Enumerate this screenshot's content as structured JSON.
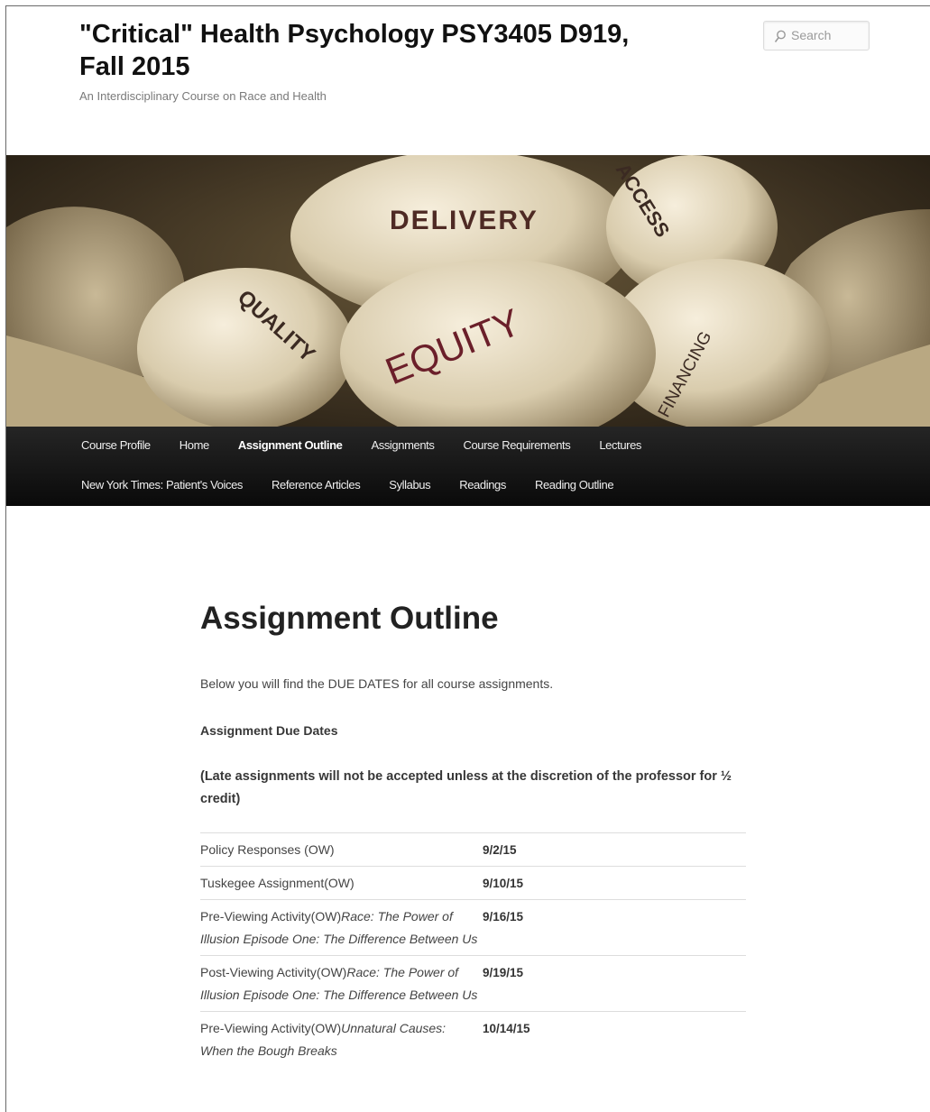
{
  "site": {
    "title": "\"Critical\" Health Psychology PSY3405 D919, Fall 2015",
    "description": "An Interdisciplinary Course on Race and Health"
  },
  "search": {
    "placeholder": "Search"
  },
  "banner": {
    "words": [
      "DELIVERY",
      "ACCESS",
      "QUALITY",
      "EQUITY",
      "FINANCING"
    ]
  },
  "nav": {
    "row1": [
      "Course Profile",
      "Home",
      "Assignment Outline",
      "Assignments",
      "Course Requirements",
      "Lectures"
    ],
    "row2": [
      "New York Times: Patient's Voices",
      "Reference Articles",
      "Syllabus",
      "Readings",
      "Reading Outline"
    ]
  },
  "page": {
    "title": "Assignment Outline",
    "intro": "Below you will find the DUE DATES for all course assignments.",
    "due_title": "Assignment Due Dates",
    "late_note": "(Late assignments will not be accepted unless at the discretion of the professor for ½ credit)"
  },
  "assignments": [
    {
      "name": "Policy Responses (OW)",
      "subtitle": "",
      "date": "9/2/15"
    },
    {
      "name": "Tuskegee Assignment(OW)",
      "subtitle": "",
      "date": "9/10/15"
    },
    {
      "name": "Pre-Viewing Activity(OW)",
      "subtitle": "Race: The Power of Illusion Episode One: The Difference Between Us",
      "date": "9/16/15"
    },
    {
      "name": "Post-Viewing Activity(OW)",
      "subtitle": "Race: The Power of Illusion Episode One: The Difference Between Us",
      "date": "9/19/15"
    },
    {
      "name": "Pre-Viewing Activity(OW)",
      "subtitle": "Unnatural Causes: When the Bough Breaks",
      "date": "10/14/15"
    }
  ]
}
